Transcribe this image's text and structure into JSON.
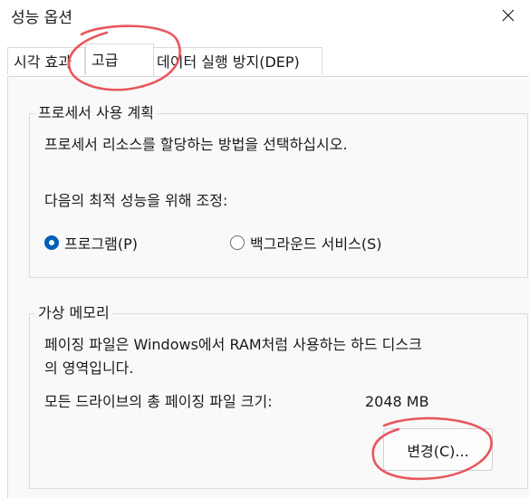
{
  "window": {
    "title": "성능 옵션"
  },
  "tabs": [
    {
      "label": "시각 효과"
    },
    {
      "label": "고급"
    },
    {
      "label": "데이터 실행 방지(DEP)"
    }
  ],
  "processor_scheduling": {
    "heading": "프로세서 사용 계획",
    "description": "프로세서 리소스를 할당하는 방법을 선택하십시오.",
    "adjust_label": "다음의 최적 성능을 위해 조정:",
    "options": [
      {
        "label": "프로그램(P)",
        "selected": true
      },
      {
        "label": "백그라운드 서비스(S)",
        "selected": false
      }
    ]
  },
  "virtual_memory": {
    "heading": "가상 메모리",
    "description_line1": "페이징 파일은 Windows에서 RAM처럼 사용하는 하드 디스크",
    "description_line2": "의 영역입니다.",
    "total_label": "모든 드라이브의 총 페이징 파일 크기:",
    "total_value": "2048 MB",
    "change_button": "변경(C)..."
  },
  "colors": {
    "accent": "#005fb8",
    "annotation": "#e8575f"
  },
  "icons": {
    "close": "close-icon"
  }
}
